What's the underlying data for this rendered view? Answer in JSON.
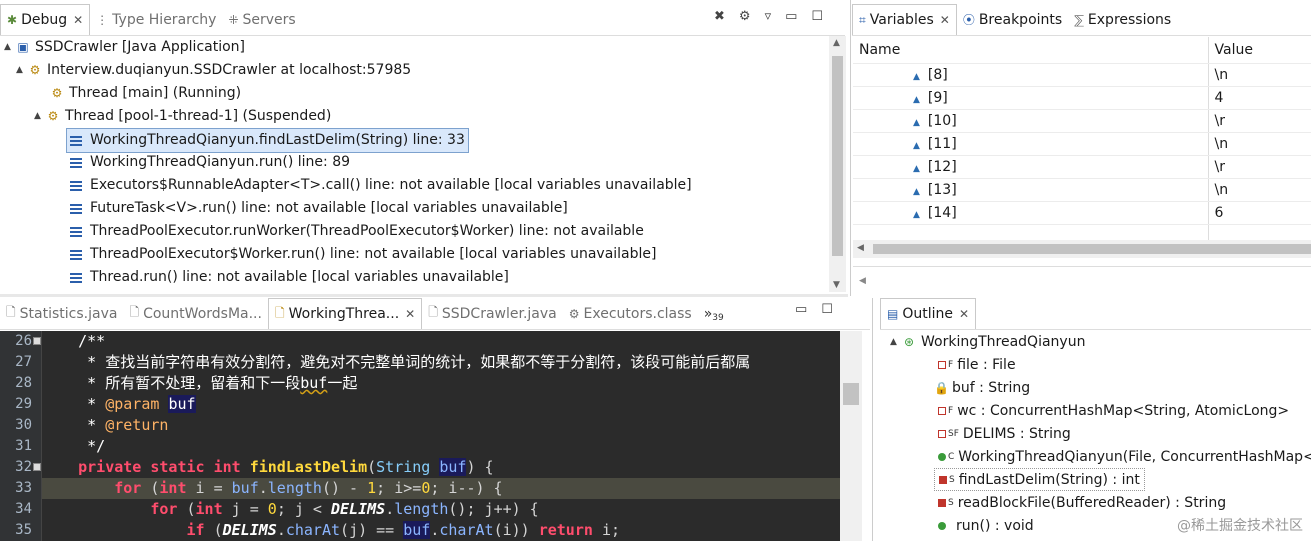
{
  "debug": {
    "tabs": [
      {
        "label": "Debug"
      },
      {
        "label": "Type Hierarchy"
      },
      {
        "label": "Servers"
      }
    ],
    "tree": [
      "SSDCrawler [Java Application]",
      "Interview.duqianyun.SSDCrawler at localhost:57985",
      "Thread [main] (Running)",
      "Thread [pool-1-thread-1] (Suspended)",
      "WorkingThreadQianyun.findLastDelim(String) line: 33",
      "WorkingThreadQianyun.run() line: 89",
      "Executors$RunnableAdapter<T>.call() line: not available [local variables unavailable]",
      "FutureTask<V>.run() line: not available [local variables unavailable]",
      "ThreadPoolExecutor.runWorker(ThreadPoolExecutor$Worker) line: not available",
      "ThreadPoolExecutor$Worker.run() line: not available [local variables unavailable]",
      "Thread.run() line: not available [local variables unavailable]"
    ]
  },
  "variables": {
    "tabs": [
      "Variables",
      "Breakpoints",
      "Expressions"
    ],
    "col_name": "Name",
    "col_value": "Value",
    "rows": [
      {
        "name": "[8]",
        "value": "\\n"
      },
      {
        "name": "[9]",
        "value": "4"
      },
      {
        "name": "[10]",
        "value": "\\r"
      },
      {
        "name": "[11]",
        "value": "\\n"
      },
      {
        "name": "[12]",
        "value": "\\r"
      },
      {
        "name": "[13]",
        "value": "\\n"
      },
      {
        "name": "[14]",
        "value": "6"
      }
    ]
  },
  "editor": {
    "tabs": [
      "Statistics.java",
      "CountWordsMa...",
      "WorkingThrea...",
      "SSDCrawler.java",
      "Executors.class"
    ],
    "overflow": "»",
    "overflow_count": "39",
    "lines": [
      "26",
      "27",
      "28",
      "29",
      "30",
      "31",
      "32",
      "33",
      "34",
      "35"
    ],
    "comment1": "/**",
    "comment2": " * 查找当前字符串有效分割符，避免对不完整单词的统计，如果都不等于分割符，该段可能前后都属",
    "comment3a": " * 所有暂不处理，留着和下一段",
    "comment3b": "buf",
    "comment3c": "一起",
    "param_tag": "@param",
    "param_name": "buf",
    "return_tag": "@return",
    "comment_end": " */"
  },
  "outline": {
    "tab": "Outline",
    "root": "WorkingThreadQianyun",
    "items": [
      "file : File",
      "buf : String",
      "wc : ConcurrentHashMap<String, AtomicLong>",
      "DELIMS : String",
      "WorkingThreadQianyun(File, ConcurrentHashMap<Str",
      "findLastDelim(String) : int",
      "readBlockFile(BufferedReader) : String",
      "run() : void"
    ]
  },
  "watermark": "@稀土掘金技术社区"
}
